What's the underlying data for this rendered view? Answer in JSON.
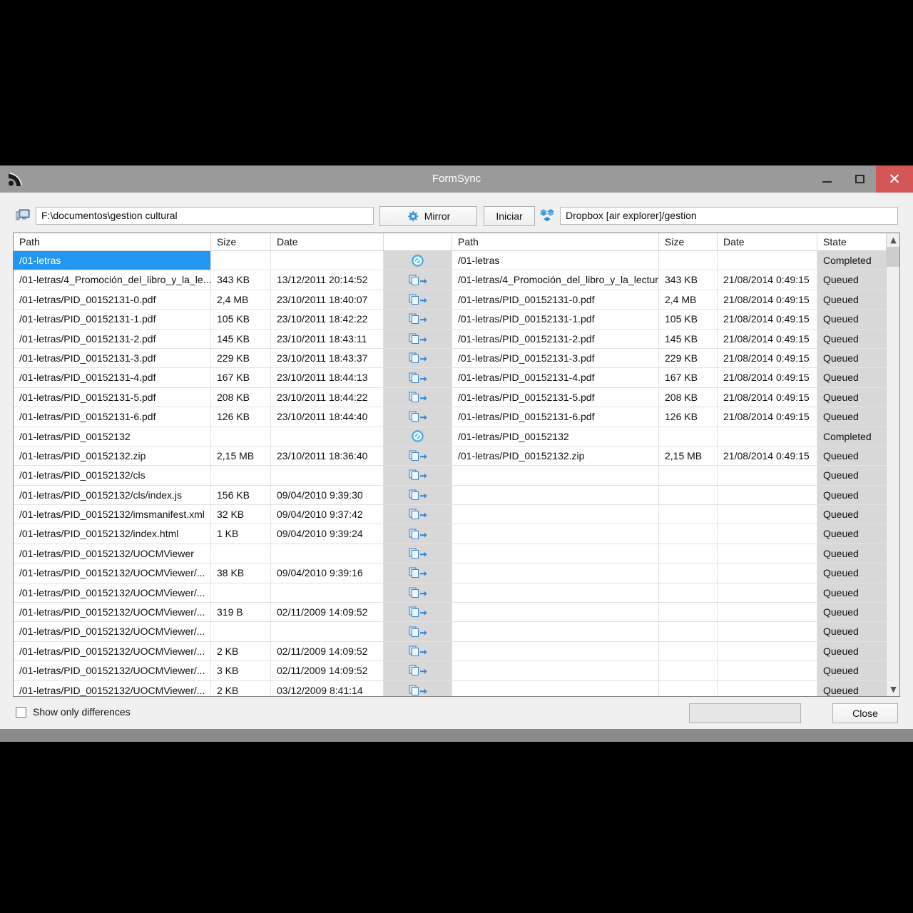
{
  "window": {
    "title": "FormSync",
    "app_icon": "formsync-logo-icon",
    "minimize_label": "minimize-icon",
    "maximize_label": "maximize-icon",
    "close_label": "close-icon",
    "close_color": "#d35757",
    "titlebar_color": "#9a9a9a"
  },
  "toolbar": {
    "source_icon": "computer-icon",
    "source_path": "F:\\documentos\\gestion cultural",
    "mirror_label": "Mirror",
    "mirror_icon": "gear-icon",
    "iniciar_label": "Iniciar",
    "dest_icon": "dropbox-icon",
    "dest_path": "Dropbox [air explorer]/gestion"
  },
  "grid": {
    "left_headers": [
      "Path",
      "Size",
      "Date"
    ],
    "action_header": "",
    "right_headers": [
      "Path",
      "Size",
      "Date"
    ],
    "state_header": "State",
    "icons": {
      "copy": "copy-arrow-icon",
      "block": "no-entry-icon"
    },
    "rows": [
      {
        "selected": true,
        "left": {
          "path": "/01-letras",
          "size": "",
          "date": ""
        },
        "action": "block",
        "right": {
          "path": "/01-letras",
          "size": "",
          "date": ""
        },
        "state": "Completed"
      },
      {
        "selected": false,
        "left": {
          "path": "/01-letras/4_Promoción_del_libro_y_la_le...",
          "size": "343 KB",
          "date": "13/12/2011 20:14:52"
        },
        "action": "copy",
        "right": {
          "path": "/01-letras/4_Promoción_del_libro_y_la_lectur...",
          "size": "343 KB",
          "date": "21/08/2014 0:49:15"
        },
        "state": "Queued"
      },
      {
        "selected": false,
        "left": {
          "path": "/01-letras/PID_00152131-0.pdf",
          "size": "2,4 MB",
          "date": "23/10/2011 18:40:07"
        },
        "action": "copy",
        "right": {
          "path": "/01-letras/PID_00152131-0.pdf",
          "size": "2,4 MB",
          "date": "21/08/2014 0:49:15"
        },
        "state": "Queued"
      },
      {
        "selected": false,
        "left": {
          "path": "/01-letras/PID_00152131-1.pdf",
          "size": "105 KB",
          "date": "23/10/2011 18:42:22"
        },
        "action": "copy",
        "right": {
          "path": "/01-letras/PID_00152131-1.pdf",
          "size": "105 KB",
          "date": "21/08/2014 0:49:15"
        },
        "state": "Queued"
      },
      {
        "selected": false,
        "left": {
          "path": "/01-letras/PID_00152131-2.pdf",
          "size": "145 KB",
          "date": "23/10/2011 18:43:11"
        },
        "action": "copy",
        "right": {
          "path": "/01-letras/PID_00152131-2.pdf",
          "size": "145 KB",
          "date": "21/08/2014 0:49:15"
        },
        "state": "Queued"
      },
      {
        "selected": false,
        "left": {
          "path": "/01-letras/PID_00152131-3.pdf",
          "size": "229 KB",
          "date": "23/10/2011 18:43:37"
        },
        "action": "copy",
        "right": {
          "path": "/01-letras/PID_00152131-3.pdf",
          "size": "229 KB",
          "date": "21/08/2014 0:49:15"
        },
        "state": "Queued"
      },
      {
        "selected": false,
        "left": {
          "path": "/01-letras/PID_00152131-4.pdf",
          "size": "167 KB",
          "date": "23/10/2011 18:44:13"
        },
        "action": "copy",
        "right": {
          "path": "/01-letras/PID_00152131-4.pdf",
          "size": "167 KB",
          "date": "21/08/2014 0:49:15"
        },
        "state": "Queued"
      },
      {
        "selected": false,
        "left": {
          "path": "/01-letras/PID_00152131-5.pdf",
          "size": "208 KB",
          "date": "23/10/2011 18:44:22"
        },
        "action": "copy",
        "right": {
          "path": "/01-letras/PID_00152131-5.pdf",
          "size": "208 KB",
          "date": "21/08/2014 0:49:15"
        },
        "state": "Queued"
      },
      {
        "selected": false,
        "left": {
          "path": "/01-letras/PID_00152131-6.pdf",
          "size": "126 KB",
          "date": "23/10/2011 18:44:40"
        },
        "action": "copy",
        "right": {
          "path": "/01-letras/PID_00152131-6.pdf",
          "size": "126 KB",
          "date": "21/08/2014 0:49:15"
        },
        "state": "Queued"
      },
      {
        "selected": false,
        "left": {
          "path": "/01-letras/PID_00152132",
          "size": "",
          "date": ""
        },
        "action": "block",
        "right": {
          "path": "/01-letras/PID_00152132",
          "size": "",
          "date": ""
        },
        "state": "Completed"
      },
      {
        "selected": false,
        "left": {
          "path": "/01-letras/PID_00152132.zip",
          "size": "2,15 MB",
          "date": "23/10/2011 18:36:40"
        },
        "action": "copy",
        "right": {
          "path": "/01-letras/PID_00152132.zip",
          "size": "2,15 MB",
          "date": "21/08/2014 0:49:15"
        },
        "state": "Queued"
      },
      {
        "selected": false,
        "left": {
          "path": "/01-letras/PID_00152132/cls",
          "size": "",
          "date": ""
        },
        "action": "copy",
        "right": {
          "path": "",
          "size": "",
          "date": ""
        },
        "state": "Queued"
      },
      {
        "selected": false,
        "left": {
          "path": "/01-letras/PID_00152132/cls/index.js",
          "size": "156 KB",
          "date": "09/04/2010 9:39:30"
        },
        "action": "copy",
        "right": {
          "path": "",
          "size": "",
          "date": ""
        },
        "state": "Queued"
      },
      {
        "selected": false,
        "left": {
          "path": "/01-letras/PID_00152132/imsmanifest.xml",
          "size": "32 KB",
          "date": "09/04/2010 9:37:42"
        },
        "action": "copy",
        "right": {
          "path": "",
          "size": "",
          "date": ""
        },
        "state": "Queued"
      },
      {
        "selected": false,
        "left": {
          "path": "/01-letras/PID_00152132/index.html",
          "size": "1 KB",
          "date": "09/04/2010 9:39:24"
        },
        "action": "copy",
        "right": {
          "path": "",
          "size": "",
          "date": ""
        },
        "state": "Queued"
      },
      {
        "selected": false,
        "left": {
          "path": "/01-letras/PID_00152132/UOCMViewer",
          "size": "",
          "date": ""
        },
        "action": "copy",
        "right": {
          "path": "",
          "size": "",
          "date": ""
        },
        "state": "Queued"
      },
      {
        "selected": false,
        "left": {
          "path": "/01-letras/PID_00152132/UOCMViewer/...",
          "size": "38 KB",
          "date": "09/04/2010 9:39:16"
        },
        "action": "copy",
        "right": {
          "path": "",
          "size": "",
          "date": ""
        },
        "state": "Queued"
      },
      {
        "selected": false,
        "left": {
          "path": "/01-letras/PID_00152132/UOCMViewer/...",
          "size": "",
          "date": ""
        },
        "action": "copy",
        "right": {
          "path": "",
          "size": "",
          "date": ""
        },
        "state": "Queued"
      },
      {
        "selected": false,
        "left": {
          "path": "/01-letras/PID_00152132/UOCMViewer/...",
          "size": "319 B",
          "date": "02/11/2009 14:09:52"
        },
        "action": "copy",
        "right": {
          "path": "",
          "size": "",
          "date": ""
        },
        "state": "Queued"
      },
      {
        "selected": false,
        "left": {
          "path": "/01-letras/PID_00152132/UOCMViewer/...",
          "size": "",
          "date": ""
        },
        "action": "copy",
        "right": {
          "path": "",
          "size": "",
          "date": ""
        },
        "state": "Queued"
      },
      {
        "selected": false,
        "left": {
          "path": "/01-letras/PID_00152132/UOCMViewer/...",
          "size": "2 KB",
          "date": "02/11/2009 14:09:52"
        },
        "action": "copy",
        "right": {
          "path": "",
          "size": "",
          "date": ""
        },
        "state": "Queued"
      },
      {
        "selected": false,
        "left": {
          "path": "/01-letras/PID_00152132/UOCMViewer/...",
          "size": "3 KB",
          "date": "02/11/2009 14:09:52"
        },
        "action": "copy",
        "right": {
          "path": "",
          "size": "",
          "date": ""
        },
        "state": "Queued"
      },
      {
        "selected": false,
        "left": {
          "path": "/01-letras/PID_00152132/UOCMViewer/...",
          "size": "2 KB",
          "date": "03/12/2009 8:41:14"
        },
        "action": "copy",
        "right": {
          "path": "",
          "size": "",
          "date": ""
        },
        "state": "Queued"
      }
    ]
  },
  "scrollbar": {
    "up_arrow": "chevron-up-icon",
    "down_arrow": "chevron-down-icon"
  },
  "footer": {
    "show_only_differences_label": "Show only differences",
    "show_only_differences_checked": false,
    "progress_label": "",
    "close_label": "Close"
  }
}
